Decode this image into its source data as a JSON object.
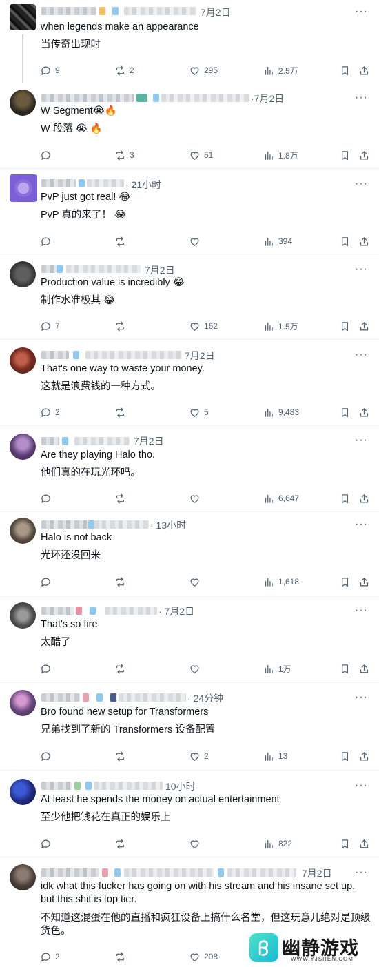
{
  "replies": [
    {
      "time": "7月2日",
      "text": "when legends make an appearance",
      "translation": "当传奇出现时",
      "stats": {
        "replies": "9",
        "reposts": "2",
        "likes": "295",
        "views": "2.5万"
      }
    },
    {
      "time": "·7月2日",
      "text": "W Segment😭🔥",
      "translation": "W 段落 😭 🔥",
      "stats": {
        "replies": "",
        "reposts": "3",
        "likes": "51",
        "views": "1.8万"
      }
    },
    {
      "time": "· 21小时",
      "text": "PvP just got real! 😂",
      "translation": "PvP 真的来了！ 😂",
      "stats": {
        "replies": "",
        "reposts": "",
        "likes": "",
        "views": "394"
      }
    },
    {
      "time": "7月2日",
      "text": "Production value is incredibly 😂",
      "translation": "制作水准极其 😂",
      "stats": {
        "replies": "7",
        "reposts": "",
        "likes": "162",
        "views": "1.5万"
      }
    },
    {
      "time": "7月2日",
      "text": "That's one way to waste your money.",
      "translation": "这就是浪费钱的一种方式。",
      "stats": {
        "replies": "2",
        "reposts": "",
        "likes": "5",
        "views": "9,483"
      }
    },
    {
      "time": "7月2日",
      "text": "Are they playing Halo tho.",
      "translation": "他们真的在玩光环吗。",
      "stats": {
        "replies": "",
        "reposts": "",
        "likes": "",
        "views": "6,647"
      }
    },
    {
      "time": "· 13小时",
      "text": "Halo is not back",
      "translation": "光环还没回来",
      "stats": {
        "replies": "",
        "reposts": "",
        "likes": "",
        "views": "1,618"
      }
    },
    {
      "time": "· 7月2日",
      "text": "That's so fire",
      "translation": "太酷了",
      "stats": {
        "replies": "",
        "reposts": "",
        "likes": "",
        "views": "1万"
      }
    },
    {
      "time": "· 24分钟",
      "text": "Bro found new setup for Transformers",
      "translation": "兄弟找到了新的 Transformers 设备配置",
      "stats": {
        "replies": "",
        "reposts": "",
        "likes": "2",
        "views": "13"
      }
    },
    {
      "time": "10小时",
      "text": "At least he spends the money on actual entertainment",
      "translation": "至少他把钱花在真正的娱乐上",
      "stats": {
        "replies": "",
        "reposts": "",
        "likes": "",
        "views": "822"
      }
    },
    {
      "time": "7月2日",
      "text": "idk what this fucker has going on with his stream and his insane set up, but this shit is top tier.",
      "translation": "不知道这混蛋在他的直播和疯狂设备上搞什么名堂，但这玩意儿绝对是顶级货色。",
      "stats": {
        "replies": "2",
        "reposts": "",
        "likes": "208",
        "views": ""
      }
    }
  ],
  "more_glyph": "···",
  "watermark": {
    "title": "幽静游戏",
    "url": "WWW.YJSREN.COM"
  },
  "icons": [
    "reply-icon",
    "repost-icon",
    "like-icon",
    "views-icon",
    "bookmark-icon",
    "share-icon",
    "more-icon"
  ]
}
